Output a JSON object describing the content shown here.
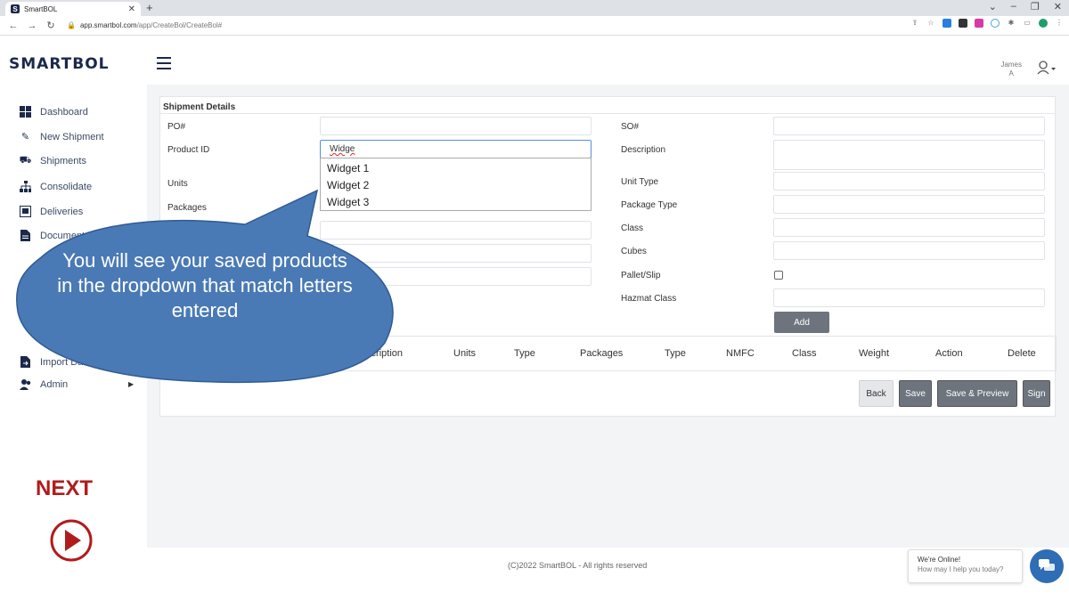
{
  "browser": {
    "tab_title": "SmartBOL",
    "tab_favicon": "S",
    "url_host": "app.smartbol.com",
    "url_path": "/app/CreateBol/CreateBol#"
  },
  "app": {
    "logo": "SMARTBOL",
    "user_first": "James",
    "user_last": "A"
  },
  "sidebar": {
    "items": [
      {
        "label": "Dashboard",
        "icon": "dashboard-icon"
      },
      {
        "label": "New Shipment",
        "icon": "edit-icon"
      },
      {
        "label": "Shipments",
        "icon": "truck-icon"
      },
      {
        "label": "Consolidate",
        "icon": "sitemap-icon"
      },
      {
        "label": "Deliveries",
        "icon": "inbox-icon"
      },
      {
        "label": "Documents",
        "icon": "document-icon"
      },
      {
        "label": "Import Data",
        "icon": "import-icon"
      },
      {
        "label": "Admin",
        "icon": "users-icon"
      }
    ],
    "next_label": "NEXT"
  },
  "form": {
    "section_title": "Shipment Details",
    "left_labels": [
      "PO#",
      "Product ID",
      "Units",
      "Packages"
    ],
    "right_labels": [
      "SO#",
      "Description",
      "Unit Type",
      "Package Type",
      "Class",
      "Cubes",
      "Pallet/Slip",
      "Hazmat Class"
    ],
    "product_id_value": "Widge",
    "dropdown_options": [
      "Widget 1",
      "Widget 2",
      "Widget 3"
    ],
    "add_button": "Add"
  },
  "table": {
    "headers": [
      "Description",
      "Units",
      "Type",
      "Packages",
      "Type",
      "NMFC",
      "Class",
      "Weight",
      "Action",
      "Delete"
    ]
  },
  "actions": {
    "back": "Back",
    "save": "Save",
    "save_preview": "Save & Preview",
    "sign": "Sign"
  },
  "callout": {
    "text": "You will see your saved products in the dropdown that match letters entered",
    "color": "#4a7ab5"
  },
  "footer": {
    "copyright": "(C)2022 SmartBOL - All rights reserved",
    "chat_line1": "We're Online!",
    "chat_line2": "How may I help you today?"
  }
}
